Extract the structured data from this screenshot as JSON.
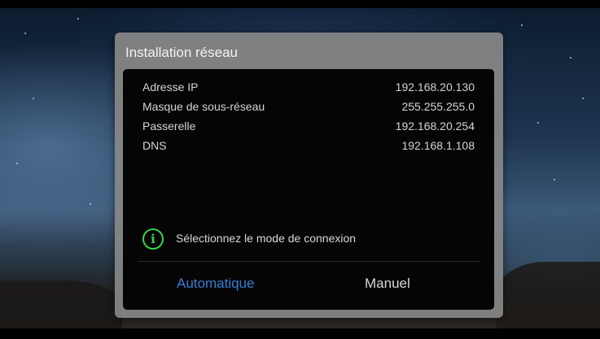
{
  "dialog": {
    "title": "Installation réseau",
    "rows": [
      {
        "label": "Adresse IP",
        "value": "192.168.20.130"
      },
      {
        "label": "Masque de sous-réseau",
        "value": "255.255.255.0"
      },
      {
        "label": "Passerelle",
        "value": "192.168.20.254"
      },
      {
        "label": "DNS",
        "value": "192.168.1.108"
      }
    ],
    "hint": {
      "icon": "info-icon",
      "icon_glyph": "i",
      "text": "Sélectionnez le mode de connexion"
    },
    "buttons": {
      "automatic": "Automatique",
      "manual": "Manuel"
    }
  },
  "colors": {
    "accent_selected": "#2e7fd8",
    "info_icon": "#35d24a"
  }
}
